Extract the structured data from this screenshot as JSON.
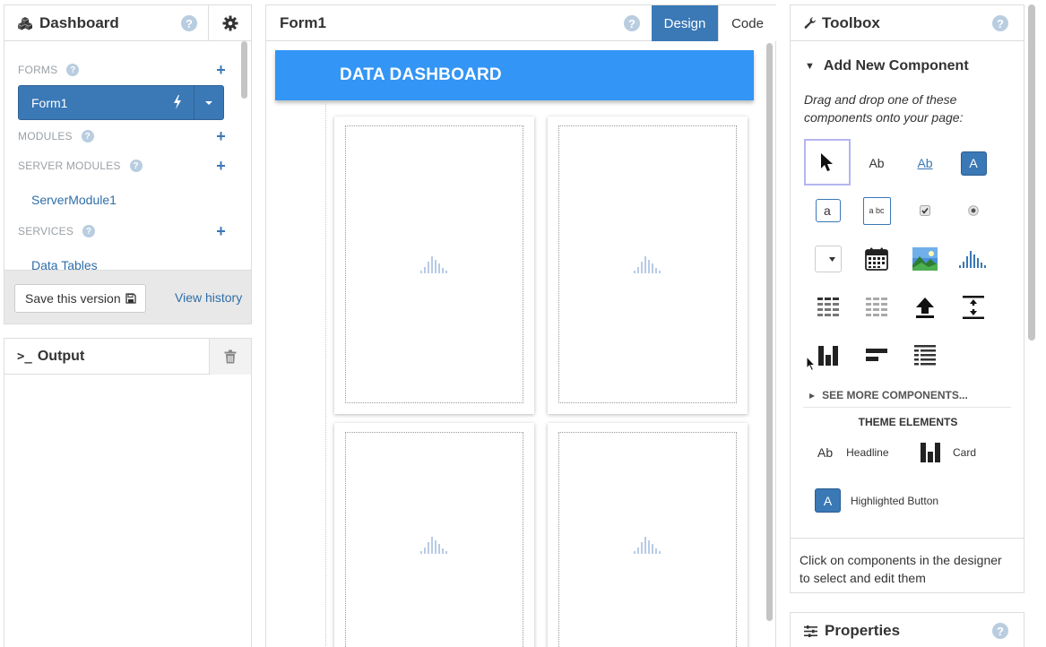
{
  "left_panel": {
    "title": "Dashboard",
    "help": "?",
    "sections": {
      "forms": "FORMS",
      "modules": "MODULES",
      "server_modules": "SERVER MODULES",
      "services": "SERVICES"
    },
    "form_item": "Form1",
    "server_module_item": "ServerModule1",
    "service_item": "Data Tables",
    "plus": "+",
    "save_label": "Save this version",
    "view_history": "View history"
  },
  "output_panel": {
    "prompt": ">_",
    "title": "Output"
  },
  "center_panel": {
    "title": "Form1",
    "help": "?",
    "tab_design": "Design",
    "tab_code": "Code",
    "banner": "DATA DASHBOARD"
  },
  "toolbox": {
    "title": "Toolbox",
    "help": "?",
    "add_title": "Add New Component",
    "description": "Drag and drop one of these components onto your page:",
    "tools": {
      "label": "Ab",
      "link": "Ab",
      "button": "A",
      "textbox": "a",
      "textarea": "a bc"
    },
    "see_more": "SEE MORE COMPONENTS...",
    "theme_title": "THEME ELEMENTS",
    "theme_items": {
      "headline": "Headline",
      "card": "Card",
      "highlighted_button": "Highlighted Button"
    },
    "headline_icon": "Ab",
    "highlighted_icon": "A",
    "footer_hint": "Click on components in the designer to select and edit them"
  },
  "properties": {
    "title": "Properties",
    "help": "?"
  },
  "colors": {
    "accent_blue": "#3a78b6",
    "banner_blue": "#3395f5",
    "link_blue": "#2f6ea8",
    "chart_icon": "#b8cbe6"
  }
}
